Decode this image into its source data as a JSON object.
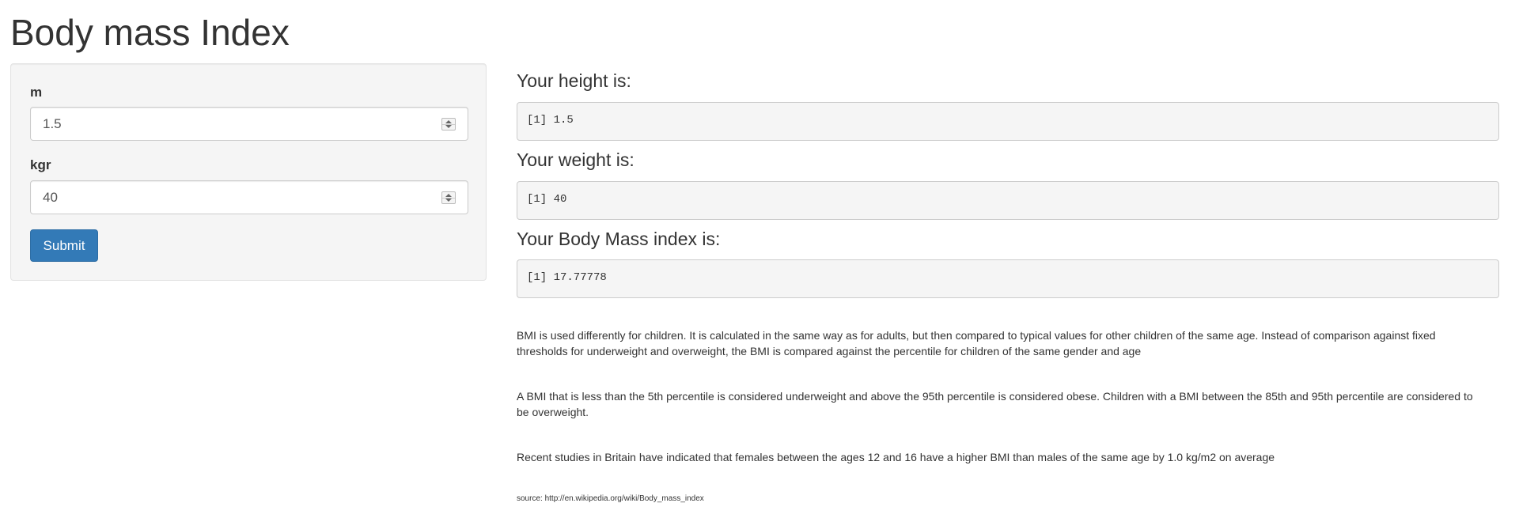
{
  "page": {
    "title": "Body mass Index"
  },
  "sidebar": {
    "height_label": "m",
    "height_value": "1.5",
    "weight_label": "kgr",
    "weight_value": "40",
    "submit_label": "Submit"
  },
  "main": {
    "height_heading": "Your height is:",
    "height_output": "[1] 1.5",
    "weight_heading": "Your weight is:",
    "weight_output": "[1] 40",
    "bmi_heading": "Your Body Mass index is:",
    "bmi_output": "[1] 17.77778",
    "paragraphs": [
      "BMI is used differently for children. It is calculated in the same way as for adults, but then compared to typical values for other children of the same age. Instead of comparison against fixed thresholds for underweight and overweight, the BMI is compared against the percentile for children of the same gender and age",
      "A BMI that is less than the 5th percentile is considered underweight and above the 95th percentile is considered obese. Children with a BMI between the 85th and 95th percentile are considered to be overweight.",
      "Recent studies in Britain have indicated that females between the ages 12 and 16 have a higher BMI than males of the same age by 1.0 kg/m2 on average"
    ],
    "source": "source: http://en.wikipedia.org/wiki/Body_mass_index"
  },
  "colors": {
    "primary_button": "#337ab7",
    "panel_background": "#f5f5f5",
    "text": "#333333"
  }
}
